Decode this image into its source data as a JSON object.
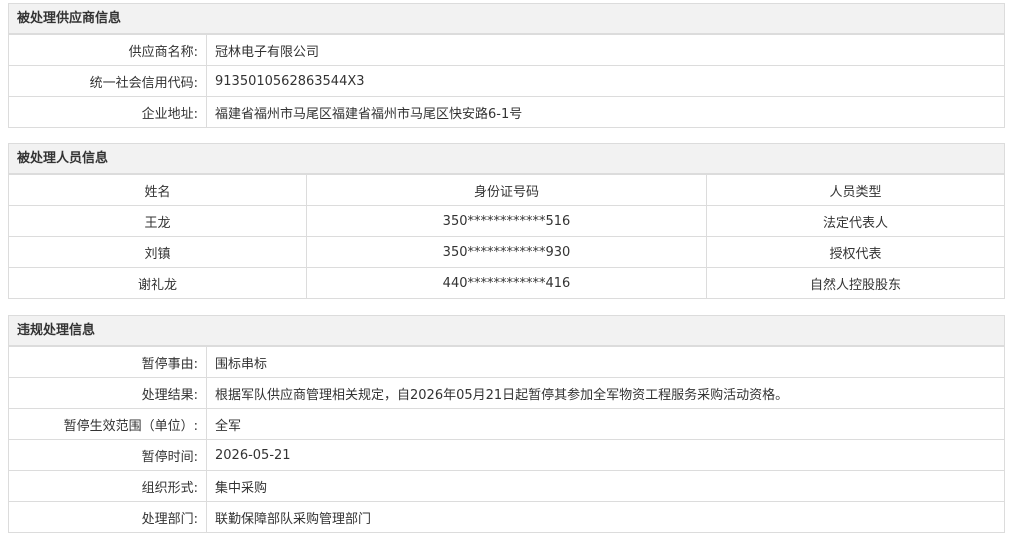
{
  "supplier": {
    "title": "被处理供应商信息",
    "rows": [
      {
        "label": "供应商名称:",
        "value": "冠林电子有限公司"
      },
      {
        "label": "统一社会信用代码:",
        "value": "913501056286354​4X3"
      },
      {
        "label": "企业地址:",
        "value": "福建省福州市马尾区福建省福州市马尾区快安路6-1号"
      }
    ]
  },
  "persons": {
    "title": "被处理人员信息",
    "headers": [
      "姓名",
      "身份证号码",
      "人员类型"
    ],
    "rows": [
      [
        "王龙",
        "350************516",
        "法定代表人"
      ],
      [
        "刘镇",
        "350************930",
        "授权代表"
      ],
      [
        "谢礼龙",
        "440************416",
        "自然人控股股东"
      ]
    ]
  },
  "violation": {
    "title": "违规处理信息",
    "rows": [
      {
        "label": "暂停事由:",
        "value": "围标串标"
      },
      {
        "label": "处理结果:",
        "value": "根据军队供应商管理相关规定，自2026年05月21日起暂停其参加全军物资工程服务采购活动资格。"
      },
      {
        "label": "暂停生效范围（单位）:",
        "value": "全军"
      },
      {
        "label": "暂停时间:",
        "value": "2026-05-21"
      },
      {
        "label": "组织形式:",
        "value": "集中采购"
      },
      {
        "label": "处理部门:",
        "value": "联勤保障部队采购管理部门"
      }
    ]
  }
}
